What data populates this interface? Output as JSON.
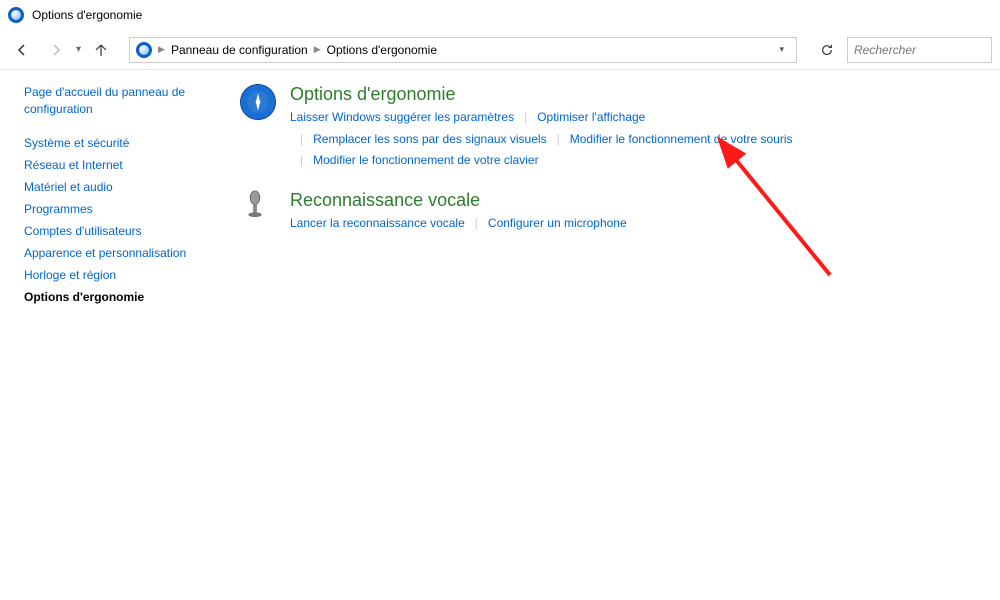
{
  "window": {
    "title": "Options d'ergonomie"
  },
  "breadcrumb": {
    "root": "Panneau de configuration",
    "current": "Options d'ergonomie"
  },
  "search": {
    "placeholder": "Rechercher"
  },
  "sidebar": {
    "home": "Page d'accueil du panneau de configuration",
    "items": [
      {
        "label": "Système et sécurité"
      },
      {
        "label": "Réseau et Internet"
      },
      {
        "label": "Matériel et audio"
      },
      {
        "label": "Programmes"
      },
      {
        "label": "Comptes d'utilisateurs"
      },
      {
        "label": "Apparence et personnalisation"
      },
      {
        "label": "Horloge et région"
      },
      {
        "label": "Options d'ergonomie"
      }
    ],
    "active_index": 7
  },
  "categories": [
    {
      "title": "Options d'ergonomie",
      "links": [
        "Laisser Windows suggérer les paramètres",
        "Optimiser l'affichage",
        "Remplacer les sons par des signaux visuels",
        "Modifier le fonctionnement de votre souris",
        "Modifier le fonctionnement de votre clavier"
      ]
    },
    {
      "title": "Reconnaissance vocale",
      "links": [
        "Lancer la reconnaissance vocale",
        "Configurer un microphone"
      ]
    }
  ]
}
